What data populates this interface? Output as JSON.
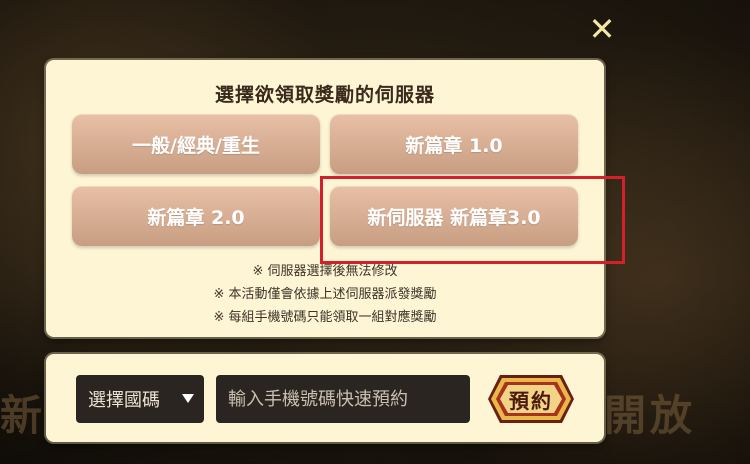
{
  "background": {
    "left_text": "新",
    "right_text": "開放"
  },
  "close_glyph": "✕",
  "server_panel": {
    "title": "選擇欲領取獎勵的伺服器",
    "options": [
      {
        "label": "一般/經典/重生"
      },
      {
        "label": "新篇章 1.0"
      },
      {
        "label": "新篇章 2.0"
      },
      {
        "label": "新伺服器 新篇章3.0"
      }
    ],
    "notes": [
      "※ 伺服器選擇後無法修改",
      "※ 本活動僅會依據上述伺服器派發獎勵",
      "※ 每組手機號碼只能領取一組對應獎勵"
    ]
  },
  "phone_panel": {
    "country_select_label": "選擇國碼",
    "phone_placeholder": "輸入手機號碼快速預約",
    "reserve_label": "預約"
  },
  "colors": {
    "panel_bg": "#fdf5d4",
    "option_bg": "#d9b094",
    "highlight_border": "#d4202a",
    "input_bg": "#2a2520",
    "reserve_gold": "#e8b84a",
    "reserve_red": "#a8321c"
  }
}
